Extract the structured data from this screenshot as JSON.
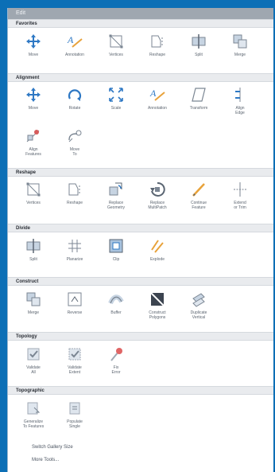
{
  "panel": {
    "title": "Edit"
  },
  "sections": {
    "favorites": {
      "title": "Favorites",
      "tools": [
        {
          "label": "Move"
        },
        {
          "label": "Annotation"
        },
        {
          "label": "Vertices"
        },
        {
          "label": "Reshape"
        },
        {
          "label": "Split"
        },
        {
          "label": "Merge"
        }
      ]
    },
    "alignment": {
      "title": "Alignment",
      "tools": [
        {
          "label": "Move"
        },
        {
          "label": "Rotate"
        },
        {
          "label": "Scale"
        },
        {
          "label": "Annotation"
        },
        {
          "label": "Transform"
        },
        {
          "label": "Align\nEdge"
        },
        {
          "label": "Align\nFeatures"
        },
        {
          "label": "Move\nTo"
        }
      ]
    },
    "reshape": {
      "title": "Reshape",
      "tools": [
        {
          "label": "Vertices"
        },
        {
          "label": "Reshape"
        },
        {
          "label": "Replace\nGeometry"
        },
        {
          "label": "Replace\nMultiPatch"
        },
        {
          "label": "Continue\nFeature"
        },
        {
          "label": "Extend\nor Trim"
        }
      ]
    },
    "divide": {
      "title": "Divide",
      "tools": [
        {
          "label": "Split"
        },
        {
          "label": "Planarize"
        },
        {
          "label": "Clip"
        },
        {
          "label": "Explode"
        }
      ]
    },
    "construct": {
      "title": "Construct",
      "tools": [
        {
          "label": "Merge"
        },
        {
          "label": "Reverse"
        },
        {
          "label": "Buffer"
        },
        {
          "label": "Construct\nPolygons"
        },
        {
          "label": "Duplicate\nVertical"
        }
      ]
    },
    "topology": {
      "title": "Topology",
      "tools": [
        {
          "label": "Validate\nAll"
        },
        {
          "label": "Validate\nExtent"
        },
        {
          "label": "Fix\nError"
        }
      ]
    },
    "topographic": {
      "title": "Topographic",
      "tools": [
        {
          "label": "Generalize\nTo Features"
        },
        {
          "label": "Populate\nSingle"
        }
      ]
    }
  },
  "footer": {
    "switch_size": "Switch Gallery Size",
    "more_tools": "More Tools..."
  },
  "colors": {
    "accent": "#0c6fb6",
    "icon_blue": "#2e78c4",
    "icon_gray": "#7b8693"
  }
}
